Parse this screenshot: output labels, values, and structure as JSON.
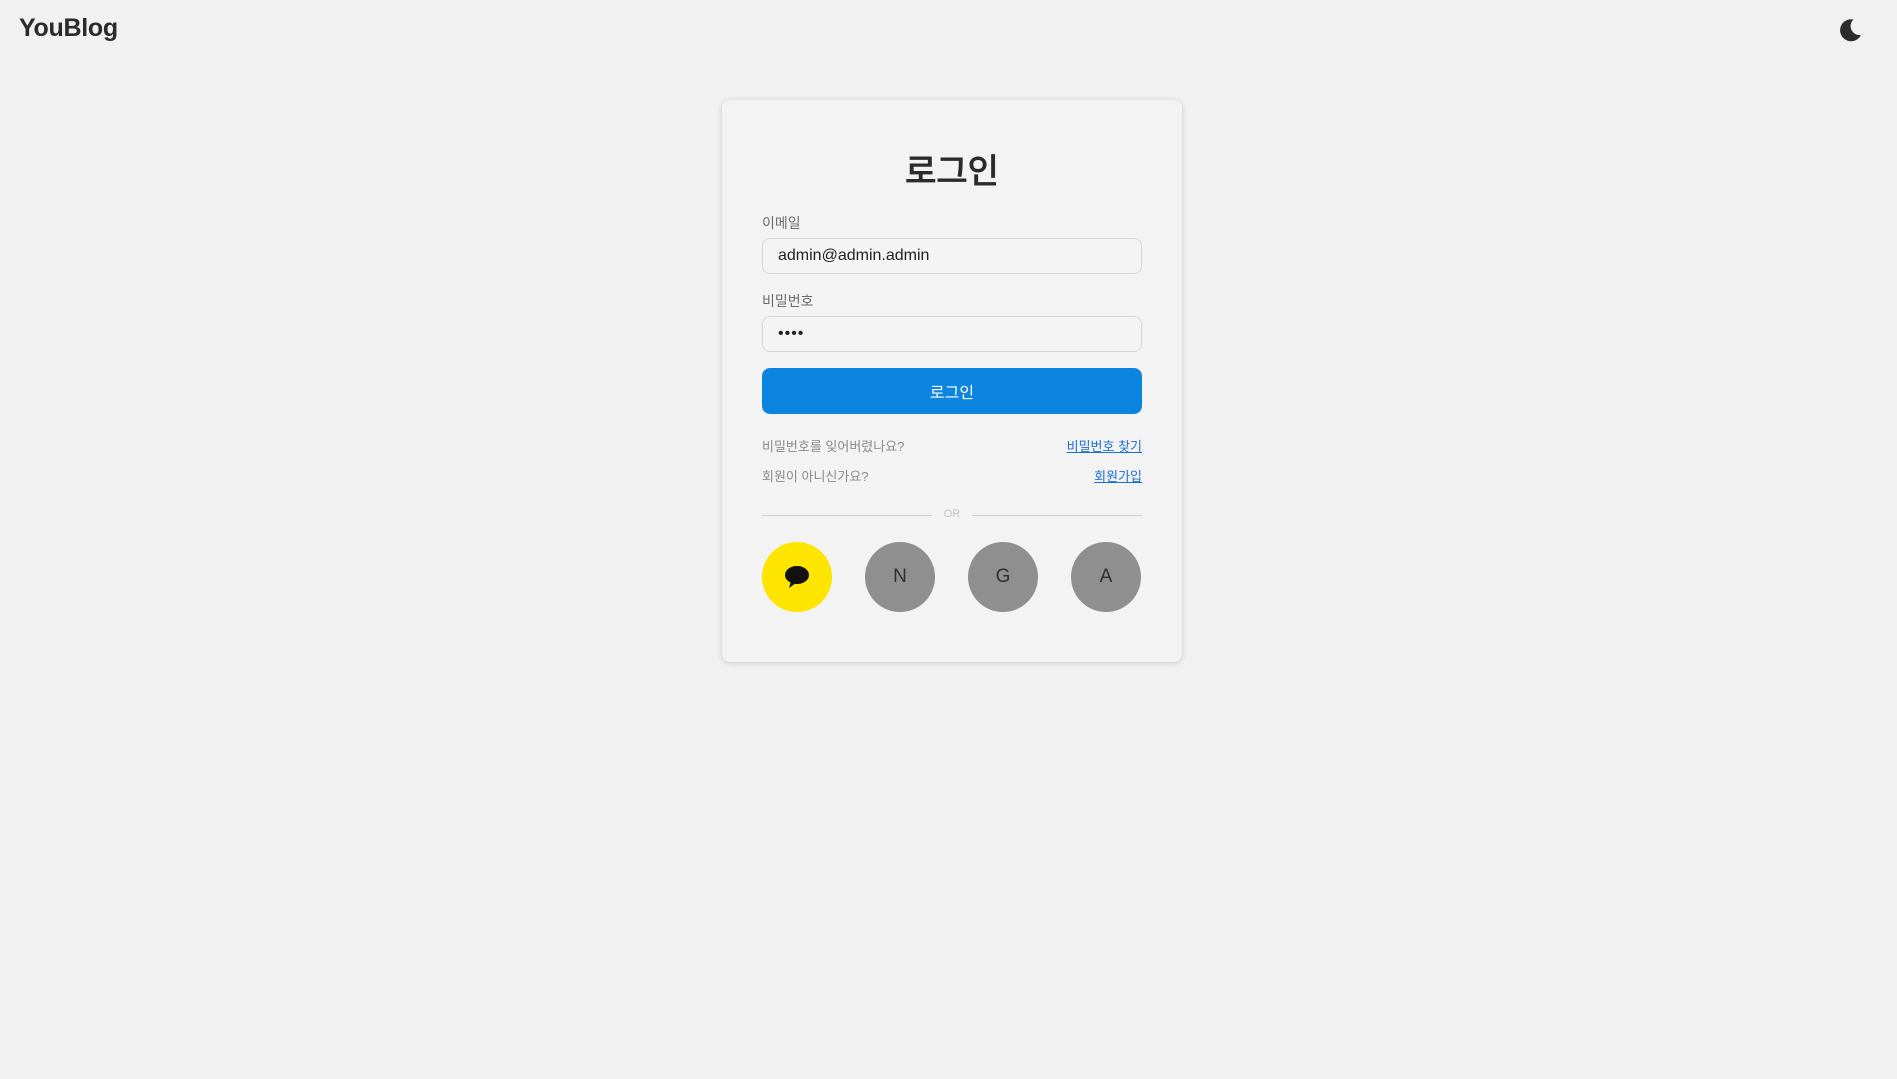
{
  "header": {
    "brand": "YouBlog",
    "theme_icon": "moon-icon"
  },
  "login": {
    "title": "로그인",
    "email_label": "이메일",
    "email_value": "admin@admin.admin",
    "password_label": "비밀번호",
    "password_value": "••••",
    "submit_label": "로그인",
    "forgot_question": "비밀번호를 잊어버렸나요?",
    "forgot_link": "비밀번호 찾기",
    "signup_question": "회원이 아니신가요?",
    "signup_link": "회원가입",
    "divider_text": "OR"
  },
  "social": [
    {
      "provider": "kakao",
      "icon": "kakao-chat-bubble-icon",
      "color": "#FEE500"
    },
    {
      "provider": "naver",
      "label": "N",
      "color": "#8F8F8F"
    },
    {
      "provider": "google",
      "label": "G",
      "color": "#8F8F8F"
    },
    {
      "provider": "apple",
      "label": "A",
      "color": "#8F8F8F"
    }
  ],
  "colors": {
    "accent": "#0C85E0",
    "link": "#1A6FD6",
    "background": "#F1F1F1"
  }
}
